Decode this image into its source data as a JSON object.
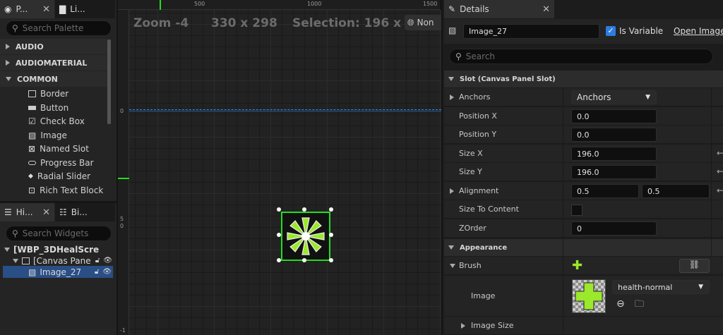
{
  "palette": {
    "tab1": "P...",
    "tab2": "Li...",
    "search_placeholder": "Search Palette",
    "categories": [
      "AUDIO",
      "AUDIOMATERIAL",
      "COMMON"
    ],
    "items": [
      "Border",
      "Button",
      "Check Box",
      "Image",
      "Named Slot",
      "Progress Bar",
      "Radial Slider",
      "Rich Text Block"
    ]
  },
  "hierarchy": {
    "tab1": "Hi...",
    "tab2": "Bi...",
    "search_placeholder": "Search Widgets",
    "root": "[WBP_3DHealScre",
    "canvas": "[Canvas Pane",
    "image": "Image_27"
  },
  "viewport": {
    "zoom": "Zoom -4",
    "size": "330 x 298",
    "selection": "Selection: 196 x 196",
    "dpi": "Non",
    "ruler_top": [
      "500",
      "1000",
      "1500"
    ],
    "ruler_left": [
      "0",
      "5",
      "0",
      "-1"
    ]
  },
  "details": {
    "tab": "Details",
    "name": "Image_27",
    "is_variable_label": "Is Variable",
    "open_image": "Open Image",
    "search_placeholder": "Search",
    "section_slot": "Slot (Canvas Panel Slot)",
    "anchors_label": "Anchors",
    "anchors_value": "Anchors",
    "position_x_label": "Position X",
    "position_x": "0.0",
    "position_y_label": "Position Y",
    "position_y": "0.0",
    "size_x_label": "Size X",
    "size_x": "196.0",
    "size_y_label": "Size Y",
    "size_y": "196.0",
    "alignment_label": "Alignment",
    "alignment_x": "0.5",
    "alignment_y": "0.5",
    "size_to_content_label": "Size To Content",
    "zorder_label": "ZOrder",
    "zorder": "0",
    "section_appearance": "Appearance",
    "brush_label": "Brush",
    "image_label": "Image",
    "image_asset": "health-normal",
    "image_size_label": "Image Size"
  },
  "colors": {
    "accent": "#2d7de0",
    "green": "#9be82c",
    "selection": "#22dd22"
  }
}
